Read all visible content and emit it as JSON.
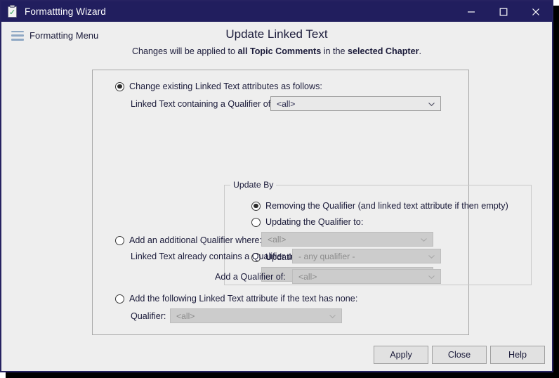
{
  "window": {
    "title": "Formattting Wizard",
    "icon": "clipboard-check-icon",
    "controls": {
      "minimize": "minimize-icon",
      "maximize": "maximize-icon",
      "close": "close-icon"
    }
  },
  "header": {
    "menu_label": "Formatting Menu",
    "menu_icon": "hamburger-icon",
    "title": "Update Linked Text",
    "subtitle_parts": {
      "p1": "Changes will be applied to ",
      "b1": "all Topic Comments",
      "p2": " in the ",
      "b2": "selected Chapter",
      "p3": "."
    }
  },
  "sections": {
    "change_existing": {
      "radio_label": "Change existing Linked Text attributes as follows:",
      "selected": true,
      "qualifier_label": "Linked Text containing a Qualifier of:",
      "qualifier_value": "<all>",
      "group": {
        "title": "Update By",
        "options": [
          {
            "label": "Removing the Qualifier (and linked text attribute if then empty)",
            "selected": true
          },
          {
            "label": "Updating the Qualifier to:",
            "selected": false,
            "combo_value": "<all>",
            "combo_disabled": true
          },
          {
            "label": "Updating the Prefix/Numbering attribute to:",
            "selected": false,
            "combo_value": "",
            "combo_disabled": true
          }
        ]
      }
    },
    "add_additional": {
      "radio_label": "Add an additional Qualifier where:",
      "selected": false,
      "contains_label": "Linked Text already contains a Qualifier of:",
      "contains_value": "- any qualifier -",
      "add_label": "Add a Qualifier of:",
      "add_value": "<all>"
    },
    "add_if_none": {
      "radio_label": "Add the following Linked Text attribute if the text has none:",
      "selected": false,
      "qualifier_label": "Qualifier:",
      "qualifier_value": "<all>"
    }
  },
  "footer": {
    "apply": "Apply",
    "close": "Close",
    "help": "Help"
  },
  "colors": {
    "titlebar": "#211e5e",
    "window_border": "#262261",
    "surface": "#eeeeee",
    "text": "#1b1b3a",
    "combo_enabled_bg": "#e9e9e9",
    "combo_disabled_bg": "#cccccc",
    "hamburger": "#8fa8c4",
    "check": "#23a24d"
  }
}
